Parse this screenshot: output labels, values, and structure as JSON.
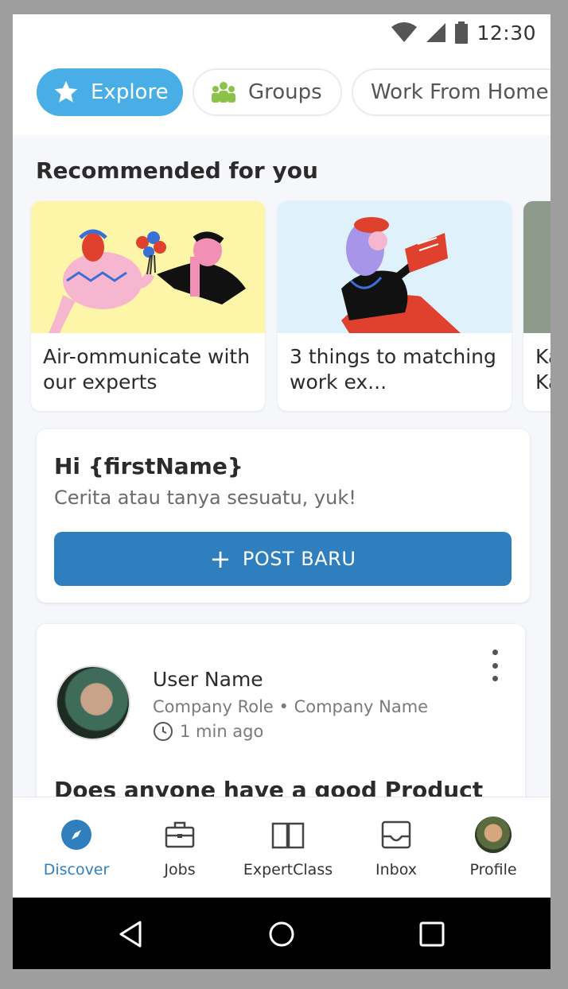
{
  "status_bar": {
    "time": "12:30"
  },
  "chips": [
    {
      "label": "Explore",
      "icon": "star-icon",
      "active": true
    },
    {
      "label": "Groups",
      "icon": "groups-icon",
      "active": false
    },
    {
      "label": "Work From Home",
      "icon": "",
      "active": false
    }
  ],
  "recommended": {
    "title": "Recommended for you",
    "cards": [
      {
        "title": "Air-ommunicate with our experts"
      },
      {
        "title": "3 things to matching work ex..."
      },
      {
        "title": "Ka Ka"
      }
    ]
  },
  "composer": {
    "greeting": "Hi {firstName}",
    "prompt": "Cerita atau tanya sesuatu, yuk!",
    "button_label": "POST BARU",
    "button_icon": "+"
  },
  "post": {
    "user_name": "User Name",
    "meta": "Company Role • Company Name",
    "time": "1 min ago",
    "question": "Does anyone have a good Product"
  },
  "bottom_nav": [
    {
      "label": "Discover",
      "icon": "compass-icon",
      "active": true
    },
    {
      "label": "Jobs",
      "icon": "briefcase-icon",
      "active": false
    },
    {
      "label": "ExpertClass",
      "icon": "book-icon",
      "active": false
    },
    {
      "label": "Inbox",
      "icon": "inbox-icon",
      "active": false
    },
    {
      "label": "Profile",
      "icon": "avatar",
      "active": false
    }
  ],
  "colors": {
    "accent": "#2f7fbf",
    "chip_active": "#4aaee6",
    "card1_bg": "#fdf6a8",
    "card2_bg": "#dff2fb"
  }
}
